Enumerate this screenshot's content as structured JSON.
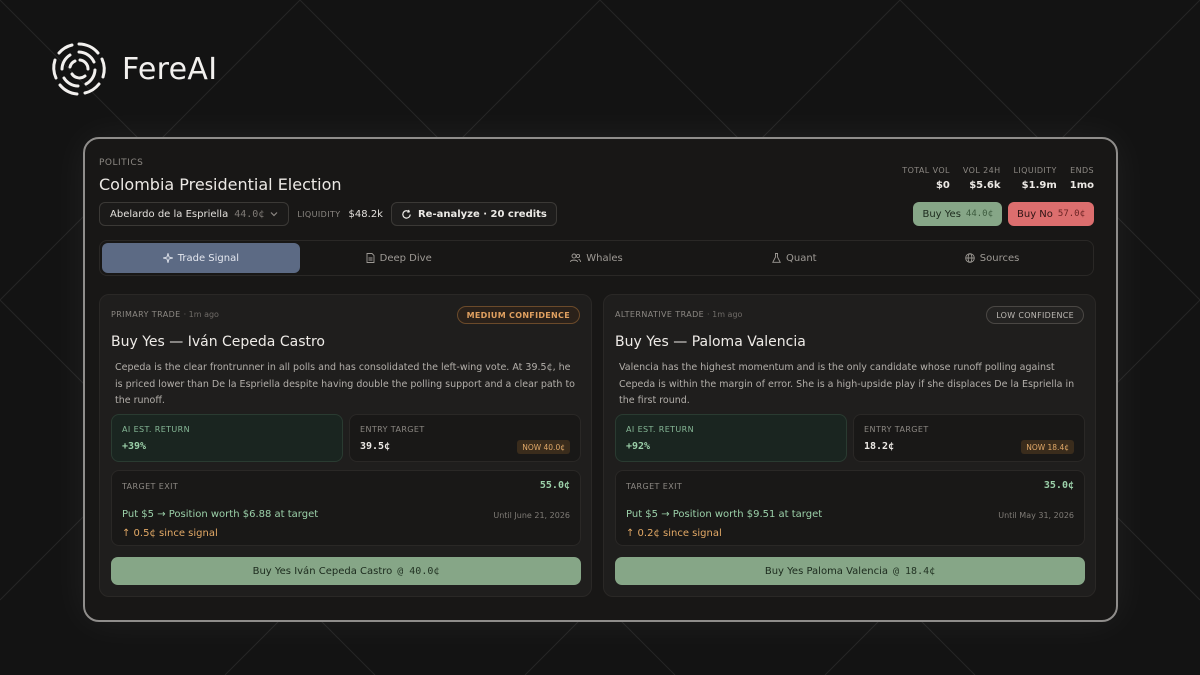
{
  "brand": {
    "name": "FereAI",
    "logo_icon": "spiral-logo-icon"
  },
  "market": {
    "category": "POLITICS",
    "title": "Colombia Presidential Election",
    "candidate_select": {
      "name": "Abelardo de la Espriella",
      "price": "44.0¢"
    },
    "liquidity_label": "LIQUIDITY",
    "liquidity_value": "$48.2k",
    "reanalyze_label": "Re-analyze · 20 credits",
    "stats": [
      {
        "label": "TOTAL VOL",
        "value": "$0"
      },
      {
        "label": "VOL 24H",
        "value": "$5.6k"
      },
      {
        "label": "LIQUIDITY",
        "value": "$1.9m"
      },
      {
        "label": "ENDS",
        "value": "1mo"
      }
    ],
    "buy_yes": {
      "label": "Buy Yes",
      "price": "44.0¢"
    },
    "buy_no": {
      "label": "Buy No",
      "price": "57.0¢"
    }
  },
  "tabs": [
    {
      "label": "Trade Signal",
      "icon": "sparkle-icon",
      "active": true
    },
    {
      "label": "Deep Dive",
      "icon": "document-icon",
      "active": false
    },
    {
      "label": "Whales",
      "icon": "users-icon",
      "active": false
    },
    {
      "label": "Quant",
      "icon": "flask-icon",
      "active": false
    },
    {
      "label": "Sources",
      "icon": "globe-icon",
      "active": false
    }
  ],
  "cards": [
    {
      "kind": "PRIMARY TRADE",
      "ago": "· 1m ago",
      "confidence": "MEDIUM CONFIDENCE",
      "title": "Buy Yes — Iván Cepeda Castro",
      "description": "Cepeda is the clear frontrunner in all polls and has consolidated the left-wing vote. At 39.5¢, he is priced lower than De la Espriella despite having double the polling support and a clear path to the runoff.",
      "return_label": "AI EST. RETURN",
      "return_value": "+39%",
      "entry_label": "ENTRY TARGET",
      "entry_value": "39.5¢",
      "now_tag": "NOW 40.0¢",
      "exit_label": "TARGET EXIT",
      "exit_value": "55.0¢",
      "put_text": "Put $5 → Position worth $6.88 at target",
      "until": "Until June 21, 2026",
      "since": "↑ 0.5¢ since signal",
      "buy_label": "Buy Yes Iván Cepeda Castro",
      "buy_price": "@ 40.0¢"
    },
    {
      "kind": "ALTERNATIVE TRADE",
      "ago": "· 1m ago",
      "confidence": "LOW CONFIDENCE",
      "title": "Buy Yes — Paloma Valencia",
      "description": "Valencia has the highest momentum and is the only candidate whose runoff polling against Cepeda is within the margin of error. She is a high-upside play if she displaces De la Espriella in the first round.",
      "return_label": "AI EST. RETURN",
      "return_value": "+92%",
      "entry_label": "ENTRY TARGET",
      "entry_value": "18.2¢",
      "now_tag": "NOW 18.4¢",
      "exit_label": "TARGET EXIT",
      "exit_value": "35.0¢",
      "put_text": "Put $5 → Position worth $9.51 at target",
      "until": "Until May 31, 2026",
      "since": "↑ 0.2¢ since signal",
      "buy_label": "Buy Yes Paloma Valencia",
      "buy_price": "@ 18.4¢"
    }
  ],
  "colors": {
    "background": "#131313",
    "panel": "#181716",
    "active_tab": "#5c6a84",
    "buy_yes": "#86a687",
    "buy_no": "#dc6e6e",
    "positive": "#9bd0a9",
    "warning": "#e3a966"
  }
}
